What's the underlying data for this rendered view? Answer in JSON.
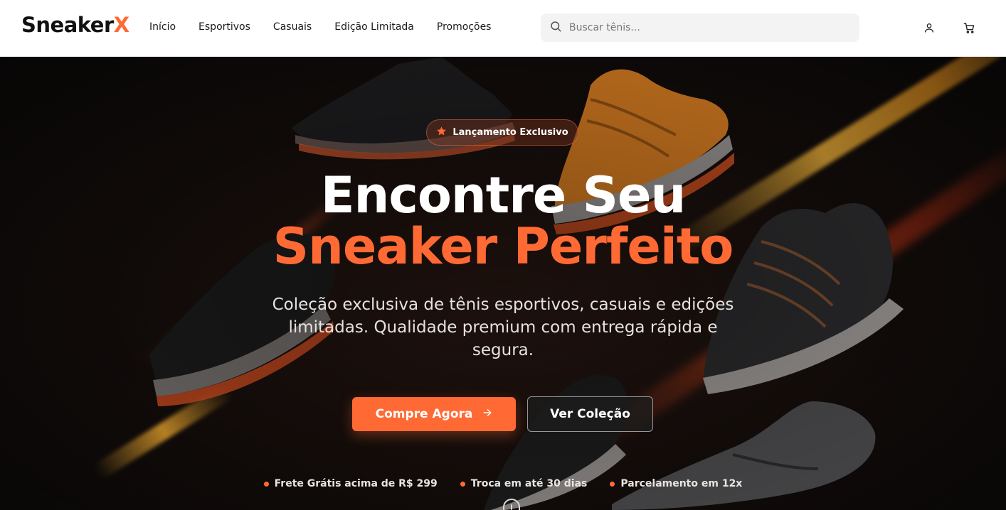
{
  "brand": {
    "name_main": "Sneaker",
    "name_accent": "X",
    "accent_color": "#ff6a34"
  },
  "nav": {
    "items": [
      {
        "label": "Início"
      },
      {
        "label": "Esportivos"
      },
      {
        "label": "Casuais"
      },
      {
        "label": "Edição Limitada"
      },
      {
        "label": "Promoções"
      }
    ]
  },
  "search": {
    "placeholder": "Buscar tênis...",
    "value": "",
    "icon": "search-icon"
  },
  "header_icons": {
    "account": "user-icon",
    "cart": "cart-icon"
  },
  "hero": {
    "badge": {
      "icon": "star-icon",
      "label": "Lançamento Exclusivo"
    },
    "title_line1": "Encontre Seu",
    "title_line2": "Sneaker Perfeito",
    "subtitle": "Coleção exclusiva de tênis esportivos, casuais e edições limitadas. Qualidade premium com entrega rápida e segura.",
    "primary_cta": {
      "label": "Compre Agora",
      "icon": "arrow-right-icon"
    },
    "secondary_cta": {
      "label": "Ver Coleção"
    },
    "features": [
      {
        "label": "Frete Grátis acima de R$ 299"
      },
      {
        "label": "Troca em até 30 dias"
      },
      {
        "label": "Parcelamento em 12x"
      }
    ]
  },
  "colors": {
    "accent": "#ff6a34",
    "hero_bg": "#0b0807",
    "text_dark": "#111111"
  }
}
